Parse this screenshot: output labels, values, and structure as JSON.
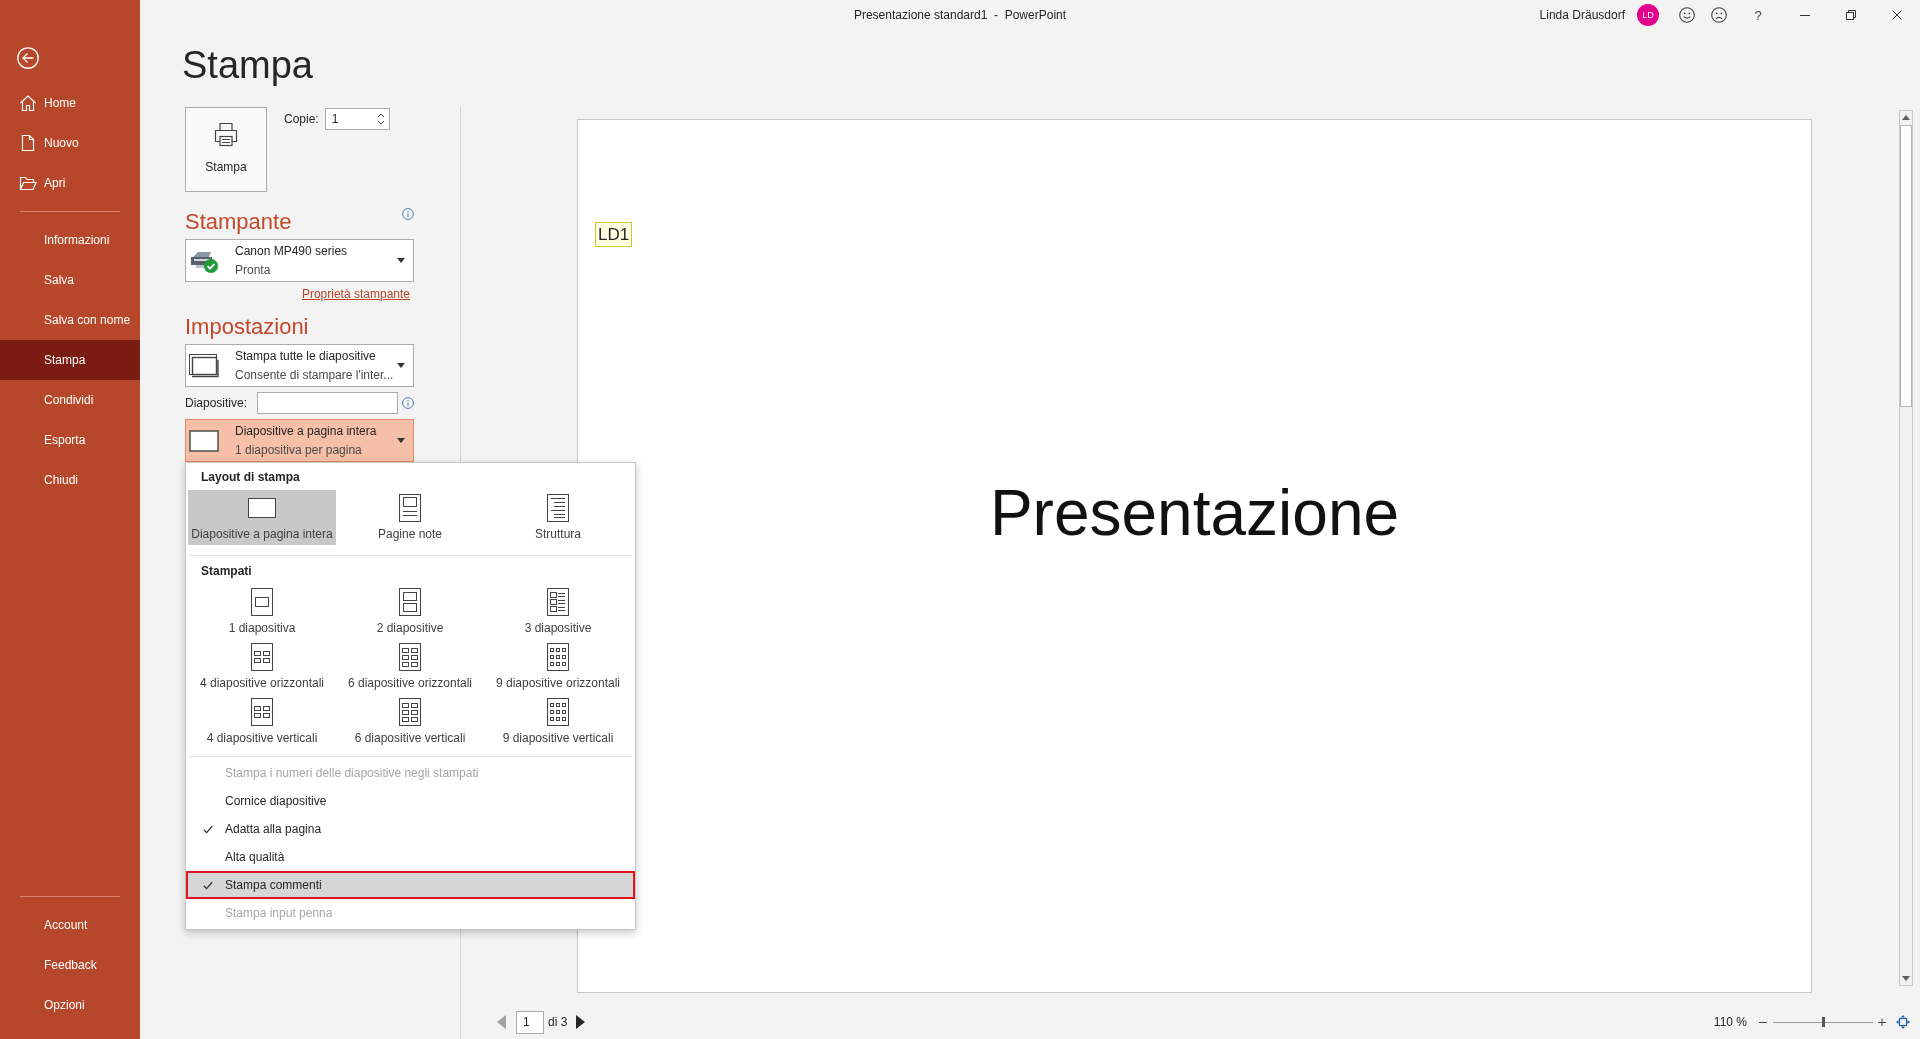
{
  "window": {
    "title": "Presentazione standard1  -  PowerPoint",
    "user": "Linda Dräusdorf",
    "avatar": "LD",
    "help": "?"
  },
  "sidebar": {
    "primary": [
      {
        "label": "Home",
        "selected": false
      },
      {
        "label": "Nuovo",
        "selected": false
      },
      {
        "label": "Apri",
        "selected": false
      }
    ],
    "secondary": [
      {
        "label": "Informazioni",
        "selected": false
      },
      {
        "label": "Salva",
        "selected": false
      },
      {
        "label": "Salva con nome",
        "selected": false
      },
      {
        "label": "Stampa",
        "selected": true
      },
      {
        "label": "Condividi",
        "selected": false
      },
      {
        "label": "Esporta",
        "selected": false
      },
      {
        "label": "Chiudi",
        "selected": false
      }
    ],
    "footer": [
      {
        "label": "Account",
        "selected": false
      },
      {
        "label": "Feedback",
        "selected": false
      },
      {
        "label": "Opzioni",
        "selected": false
      }
    ]
  },
  "print": {
    "heading": "Stampa",
    "button": "Stampa",
    "copies_label": "Copie:",
    "copies": "1"
  },
  "printer": {
    "heading": "Stampante",
    "name": "Canon MP490 series",
    "status": "Pronta",
    "properties_link": "Proprietà stampante"
  },
  "settings": {
    "heading": "Impostazioni",
    "range": {
      "title": "Stampa tutte le diapositive",
      "subtitle": "Consente di stampare l'inter..."
    },
    "slides_label": "Diapositive:",
    "layout": {
      "title": "Diapositive a pagina intera",
      "subtitle": "1 diapositiva per pagina",
      "expanded": true
    }
  },
  "layout_menu": {
    "sections": [
      {
        "heading": "Layout di stampa",
        "items": [
          {
            "label": "Diapositive a pagina intera",
            "selected": true
          },
          {
            "label": "Pagine note",
            "selected": false
          },
          {
            "label": "Struttura",
            "selected": false
          }
        ]
      },
      {
        "heading": "Stampati",
        "items": [
          {
            "label": "1 diapositiva",
            "selected": false
          },
          {
            "label": "2 diapositive",
            "selected": false
          },
          {
            "label": "3 diapositive",
            "selected": false
          },
          {
            "label": "4 diapositive orizzontali",
            "selected": false
          },
          {
            "label": "6 diapositive orizzontali",
            "selected": false
          },
          {
            "label": "9 diapositive orizzontali",
            "selected": false
          },
          {
            "label": "4 diapositive verticali",
            "selected": false
          },
          {
            "label": "6 diapositive verticali",
            "selected": false
          },
          {
            "label": "9 diapositive verticali",
            "selected": false
          }
        ]
      }
    ],
    "options": [
      {
        "label": "Stampa i numeri delle diapositive negli stampati",
        "checked": false,
        "disabled": true,
        "highlighted": false
      },
      {
        "label": "Cornice diapositive",
        "checked": false,
        "disabled": false,
        "highlighted": false
      },
      {
        "label": "Adatta alla pagina",
        "checked": true,
        "disabled": false,
        "highlighted": false
      },
      {
        "label": "Alta qualità",
        "checked": false,
        "disabled": false,
        "highlighted": false
      },
      {
        "label": "Stampa commenti",
        "checked": true,
        "disabled": false,
        "highlighted": true
      },
      {
        "label": "Stampa input penna",
        "checked": false,
        "disabled": true,
        "highlighted": false
      }
    ]
  },
  "preview": {
    "comment_marker": "LD1",
    "slide_title": "Presentazione"
  },
  "pager": {
    "page": "1",
    "total": "di 3"
  },
  "zoom": {
    "label": "110 %",
    "level": 0.5
  }
}
